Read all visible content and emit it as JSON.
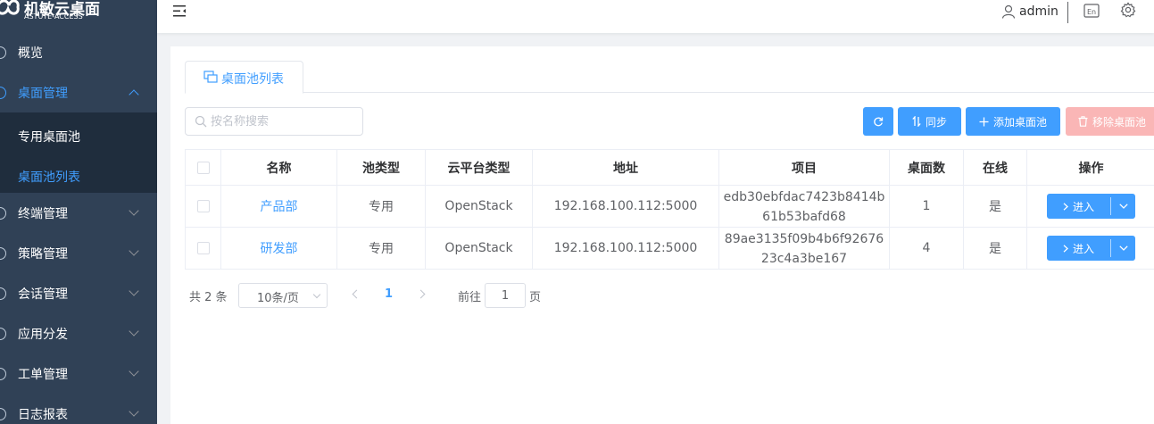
{
  "brand": {
    "name_cn": "机敏云桌面",
    "name_en": "ASTUTE-ACCESS"
  },
  "sidebar": {
    "items": [
      {
        "label": "概览"
      },
      {
        "label": "桌面管理",
        "expanded": true
      },
      {
        "label": "终端管理"
      },
      {
        "label": "策略管理"
      },
      {
        "label": "会话管理"
      },
      {
        "label": "应用分发"
      },
      {
        "label": "工单管理"
      },
      {
        "label": "日志报表"
      }
    ],
    "submenu": [
      {
        "label": "专用桌面池"
      },
      {
        "label": "桌面池列表",
        "active": true
      }
    ]
  },
  "header": {
    "user": "admin",
    "lang_icon": "language-icon",
    "settings_icon": "gear-icon"
  },
  "tabs": [
    {
      "label": "桌面池列表"
    }
  ],
  "search": {
    "placeholder": "按名称搜索"
  },
  "toolbar": {
    "sync_label": "同步",
    "add_label": "添加桌面池",
    "remove_label": "移除桌面池"
  },
  "table": {
    "columns": [
      "名称",
      "池类型",
      "云平台类型",
      "地址",
      "项目",
      "桌面数",
      "在线",
      "操作"
    ],
    "rows": [
      {
        "name": "产品部",
        "pool_type": "专用",
        "cloud": "OpenStack",
        "address": "192.168.100.112:5000",
        "project_l1": "edb30ebfdac7423b8414b",
        "project_l2": "61b53bafd68",
        "desktops": "1",
        "online": "是",
        "action": "进入"
      },
      {
        "name": "研发部",
        "pool_type": "专用",
        "cloud": "OpenStack",
        "address": "192.168.100.112:5000",
        "project_l1": "89ae3135f09b4b6f92676",
        "project_l2": "23c4a3be167",
        "desktops": "4",
        "online": "是",
        "action": "进入"
      }
    ]
  },
  "pagination": {
    "total": "共 2 条",
    "page_size": "10条/页",
    "current": "1",
    "goto_label": "前往",
    "goto_value": "1",
    "page_suffix": "页"
  },
  "colors": {
    "primary": "#409eff",
    "sidebar_bg": "#304156",
    "submenu_bg": "#1f2d3d",
    "danger_disabled": "#fab6b6"
  }
}
